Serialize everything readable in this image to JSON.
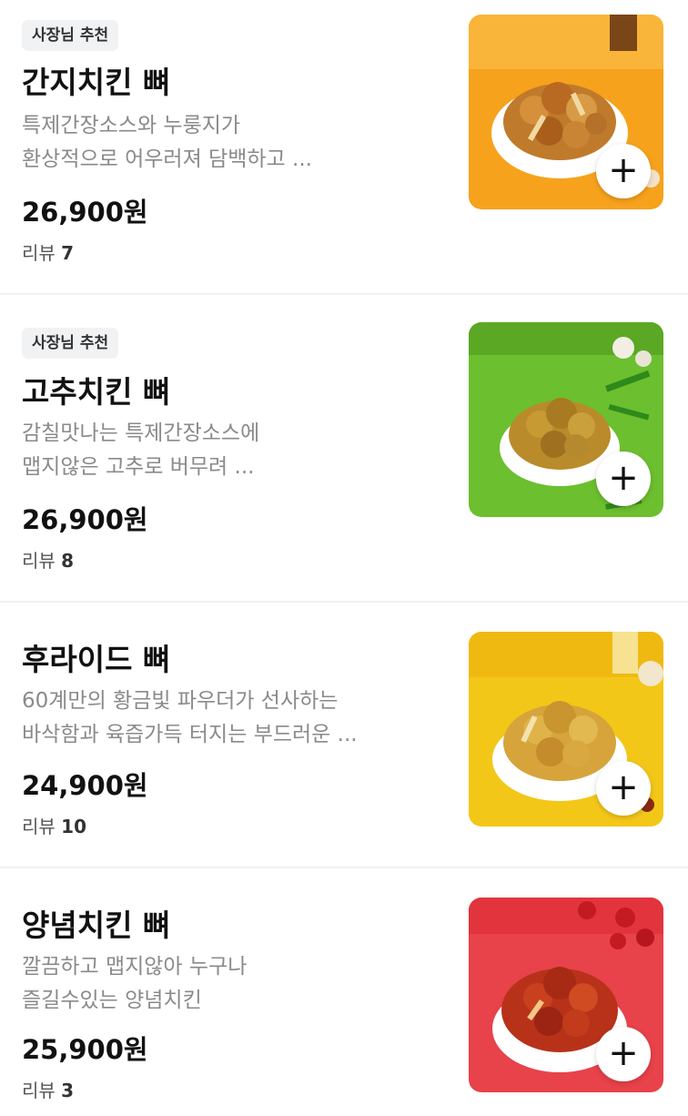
{
  "menu": {
    "items": [
      {
        "badge": "사장님 추천",
        "name": "간지치킨 뼈",
        "desc_line1": "특제간장소스와 누룽지가",
        "desc_line2": "환상적으로 어우러져 담백하고 ...",
        "price": "26,900원",
        "review_label": "리뷰",
        "review_count": "7",
        "image_bg": "#f7a21c",
        "add_icon": "plus-icon"
      },
      {
        "badge": "사장님 추천",
        "name": "고추치킨 뼈",
        "desc_line1": "감칠맛나는 특제간장소스에",
        "desc_line2": "맵지않은 고추로 버무려 ...",
        "price": "26,900원",
        "review_label": "리뷰",
        "review_count": "8",
        "image_bg": "#6cbf2e",
        "add_icon": "plus-icon"
      },
      {
        "name": "후라이드 뼈",
        "desc_line1": "60계만의 황금빛 파우더가 선사하는",
        "desc_line2": "바삭함과 육즙가득 터지는 부드러운 ...",
        "price": "24,900원",
        "review_label": "리뷰",
        "review_count": "10",
        "image_bg": "#f3c718",
        "add_icon": "plus-icon"
      },
      {
        "name": "양념치킨 뼈",
        "desc_line1": "깔끔하고 맵지않아 누구나",
        "desc_line2": "즐길수있는 양념치킨",
        "price": "25,900원",
        "review_label": "리뷰",
        "review_count": "3",
        "image_bg": "#e8424a",
        "add_icon": "plus-icon"
      }
    ]
  },
  "colors": {
    "badge_bg": "#f1f2f4",
    "text_primary": "#111111",
    "text_secondary": "#8a8a8a",
    "divider": "#f1f1f1"
  }
}
